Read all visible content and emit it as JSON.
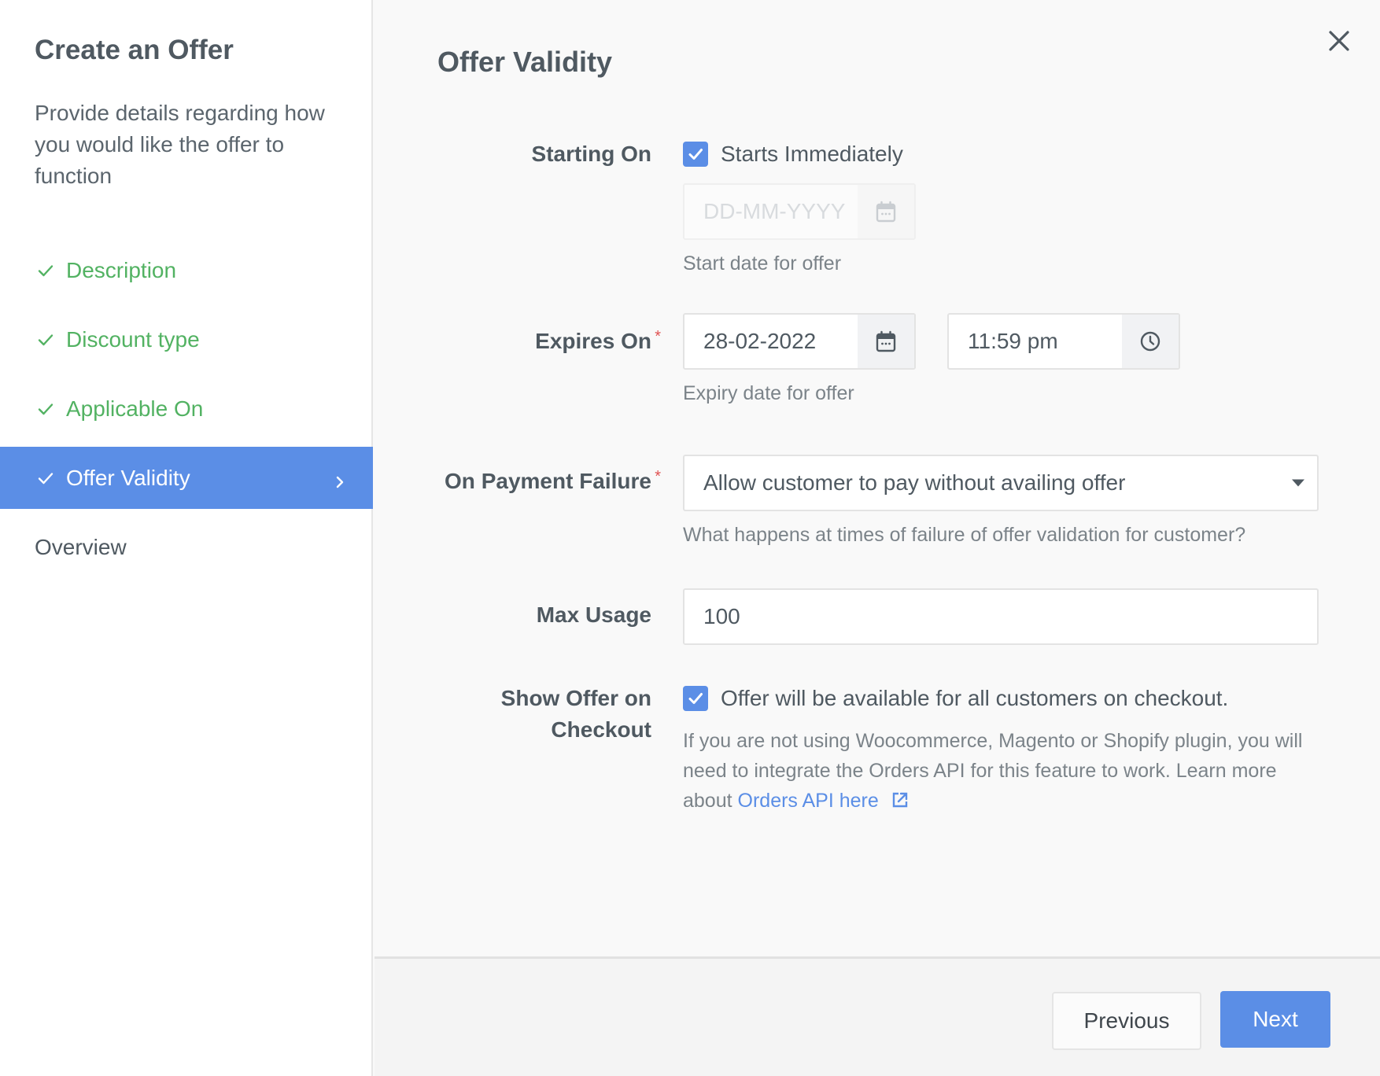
{
  "sidebar": {
    "title": "Create an Offer",
    "description": "Provide details regarding how you would like the offer to function",
    "steps": [
      {
        "label": "Description",
        "status": "done",
        "icon": "check-icon"
      },
      {
        "label": "Discount type",
        "status": "done",
        "icon": "check-icon"
      },
      {
        "label": "Applicable On",
        "status": "done",
        "icon": "check-icon"
      },
      {
        "label": "Offer Validity",
        "status": "active",
        "icon": "check-icon",
        "trailing_icon": "chevron-right-icon"
      },
      {
        "label": "Overview",
        "status": "pending"
      }
    ]
  },
  "main": {
    "title": "Offer Validity",
    "close_icon": "close-icon",
    "starting_on": {
      "label": "Starting On",
      "checkbox_label": "Starts Immediately",
      "checked": true,
      "date_placeholder": "DD-MM-YYYY",
      "date_value": "",
      "date_disabled": true,
      "help": "Start date for offer"
    },
    "expires_on": {
      "label": "Expires On",
      "required": "*",
      "date_value": "28-02-2022",
      "time_value": "11:59 pm",
      "help": "Expiry date for offer"
    },
    "payment_failure": {
      "label": "On Payment Failure",
      "required": "*",
      "selected": "Allow customer to pay without availing offer",
      "help": "What happens at times of failure of offer validation for customer?"
    },
    "max_usage": {
      "label": "Max Usage",
      "value": "100"
    },
    "show_on_checkout": {
      "label_line1": "Show Offer on",
      "label_line2": "Checkout",
      "checkbox_label": "Offer will be available for all customers on checkout.",
      "checked": true,
      "help": "If you are not using Woocommerce, Magento or Shopify plugin, you will need to integrate the Orders API for this feature to work. Learn more about",
      "link_text": "Orders API here"
    }
  },
  "footer": {
    "previous_label": "Previous",
    "next_label": "Next"
  },
  "colors": {
    "accent": "#5b8ee6",
    "success": "#52b262",
    "required": "#e05353",
    "text": "#4f5961"
  }
}
